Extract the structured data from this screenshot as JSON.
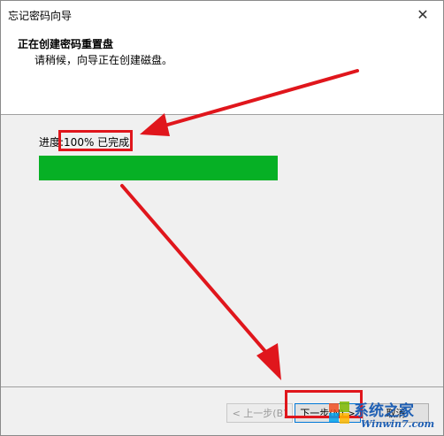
{
  "window": {
    "title": "忘记密码向导",
    "close_symbol": "✕"
  },
  "header": {
    "title": "正在创建密码重置盘",
    "subtitle": "请稍候，向导正在创建磁盘。"
  },
  "progress": {
    "prefix": "进度:",
    "status_text": "100% 已完成",
    "fraction": 1.0,
    "bar_color": "#06b025"
  },
  "buttons": {
    "back_label": "< 上一步(B)",
    "next_label": "下一步(N) >",
    "finish_label": "取消"
  },
  "annotations": {
    "highlight_color": "#e0161c"
  },
  "watermark": {
    "site_name": "系统之家",
    "site_url": "Winwin7.com"
  }
}
